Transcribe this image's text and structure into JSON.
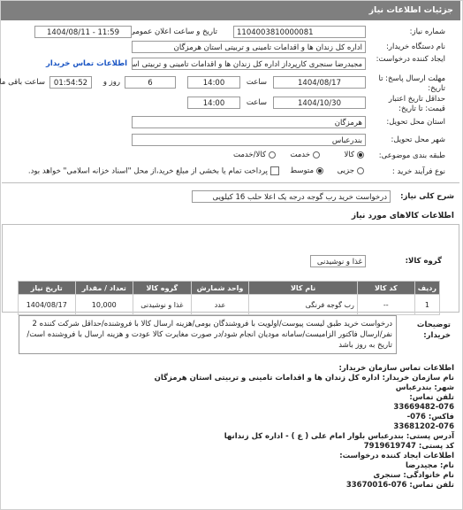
{
  "header": {
    "title": "جزئیات اطلاعات نیاز"
  },
  "fields": {
    "need_number_label": "شماره نیاز:",
    "need_number": "1104003810000081",
    "announce_date_label": "تاریخ و ساعت اعلان عمومی:",
    "announce_date": "1404/08/11 - 11:59",
    "buyer_org_label": "نام دستگاه خریدار:",
    "buyer_org": "اداره کل زندان ها و اقدامات تامینی و تربیتی استان هرمزگان",
    "requester_label": "ایجاد کننده درخواست:",
    "requester": "مجیدرضا سنجری کارپرداز اداره کل زندان ها و اقدامات تامینی و تربیتی استان هرمزگان",
    "contact_link": "اطلاعات تماس خریدار",
    "reply_deadline_label": "مهلت ارسال پاسخ: تا تاریخ:",
    "reply_date": "1404/08/17",
    "time_label": "ساعت",
    "reply_time": "14:00",
    "days_value": "6",
    "days_label": "روز و",
    "remaining_time": "01:54:52",
    "remaining_label": "ساعت باقی مانده",
    "validity_label": "حداقل تاریخ اعتبار قیمت: تا تاریخ:",
    "validity_date": "1404/10/30",
    "validity_time": "14:00",
    "province_label": "استان محل تحویل:",
    "province": "هرمزگان",
    "city_label": "شهر محل تحویل:",
    "city": "بندرعباس",
    "category_label": "طبقه بندی موضوعی:",
    "category_options": [
      "کالا",
      "خدمت",
      "کالا/خدمت"
    ],
    "process_label": "نوع فرآیند خرید :",
    "process_options": [
      "جزیی",
      "متوسط"
    ],
    "payment_note": "پرداخت تمام یا بخشی از مبلغ خرید،از محل \"اسناد خزانه اسلامی\" خواهد بود."
  },
  "general_desc": {
    "label": "شرح کلی نیاز:",
    "value": "درخواست خرید رب گوجه درجه یک اعلا حلب 16 کیلویی"
  },
  "goods": {
    "section_title": "اطلاعات کالاهای مورد نیاز",
    "group_label": "گروه کالا:",
    "group_value": "غذا و نوشیدنی",
    "columns": [
      "ردیف",
      "کد کالا",
      "نام کالا",
      "واحد شمارش",
      "گروه کالا",
      "تعداد / مقدار",
      "تاریخ نیاز"
    ],
    "rows": [
      {
        "row": "1",
        "code": "--",
        "name": "رب گوجه فرنگی",
        "unit": "عدد",
        "group": "غذا و نوشیدنی",
        "qty": "10,000",
        "date": "1404/08/17"
      }
    ]
  },
  "buyer_notes": {
    "label": "توضیحات خریدار:",
    "value": "درخواست خرید طبق لیست پیوست/اولویت با فروشندگان بومی/هزینه ارسال کالا با فروشنده/حداقل شرکت کننده 2 نفر/ارسال فاکتور الزامیست/سامانه مودیان انجام شود/در صورت مغایرت کالا عودت و هزینه ارسال با فروشنده است/ تاریخ به روز باشد"
  },
  "contact": {
    "title": "اطلاعات تماس سازمان خریدار:",
    "lines": [
      "نام سازمان خریدار: اداره کل زندان ها و اقدامات تامینی و تربیتی استان هرمزگان",
      "شهر: بندرعباس",
      "تلفن تماس:",
      "33669482-076",
      "فاکس: 076-",
      "33681202-076",
      "آدرس پستی: بندرعباس بلوار امام علی ( ع ) - اداره کل زندانها",
      "کد پستی: 7919619747",
      "اطلاعات ایجاد کننده درخواست:",
      "نام: مجیدرضا",
      "نام خانوادگی: سنجری",
      "تلفن تماس: 076-33670016"
    ]
  }
}
